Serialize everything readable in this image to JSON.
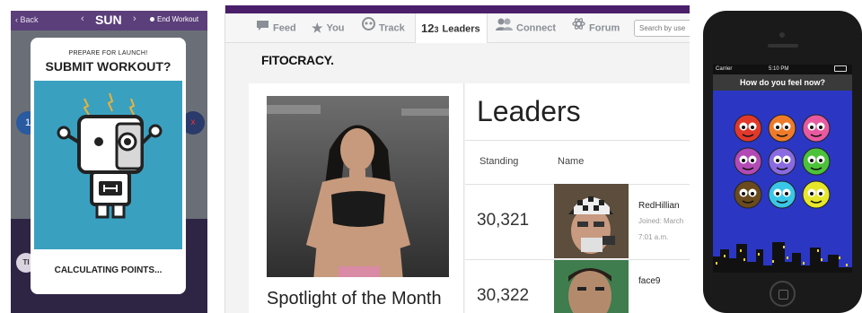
{
  "panel1": {
    "back_label": "Back",
    "day_label": "SUN",
    "end_workout_label": "End Workout",
    "modal": {
      "subtitle": "PREPARE FOR LAUNCH!",
      "title": "SUBMIT WORKOUT?",
      "status": "CALCULATING POINTS..."
    },
    "side_button_left": "1",
    "side_button_right": "x",
    "bottom_badge": "TI"
  },
  "panel2": {
    "nav_tabs": [
      {
        "label": "Feed",
        "icon": "speech-bubble-icon"
      },
      {
        "label": "You",
        "icon": "star-icon"
      },
      {
        "label": "Track",
        "icon": "robot-face-icon"
      },
      {
        "label": "Leaders",
        "icon": "numbers-123-icon"
      },
      {
        "label": "Connect",
        "icon": "people-icon"
      },
      {
        "label": "Forum",
        "icon": "atom-icon"
      }
    ],
    "active_tab": "Leaders",
    "search_placeholder": "Search by use",
    "logo": "FITOCRACY.",
    "spotlight_title": "Spotlight of the Month",
    "leaders_title": "Leaders",
    "table_headers": {
      "standing": "Standing",
      "name": "Name"
    },
    "rows": [
      {
        "standing": "30,321",
        "name": "RedHillian",
        "joined": "Joined: March",
        "time": "7:01 a.m."
      },
      {
        "standing": "30,322",
        "name": "face9",
        "joined": "",
        "time": ""
      }
    ],
    "colors": {
      "top_strip": "#4a1f6a",
      "nav_active": "#ffffff"
    }
  },
  "panel3": {
    "carrier": "Carrier",
    "time": "5:10 PM",
    "header": "How do you feel now?",
    "faces": [
      "red-angry-face-icon",
      "orange-face-icon",
      "pink-face-icon",
      "purple-face-icon",
      "lavender-face-icon",
      "green-face-icon",
      "brown-face-icon",
      "cyan-face-icon",
      "yellow-face-icon"
    ],
    "colors": {
      "screen_bg": "#2b37c2"
    }
  }
}
